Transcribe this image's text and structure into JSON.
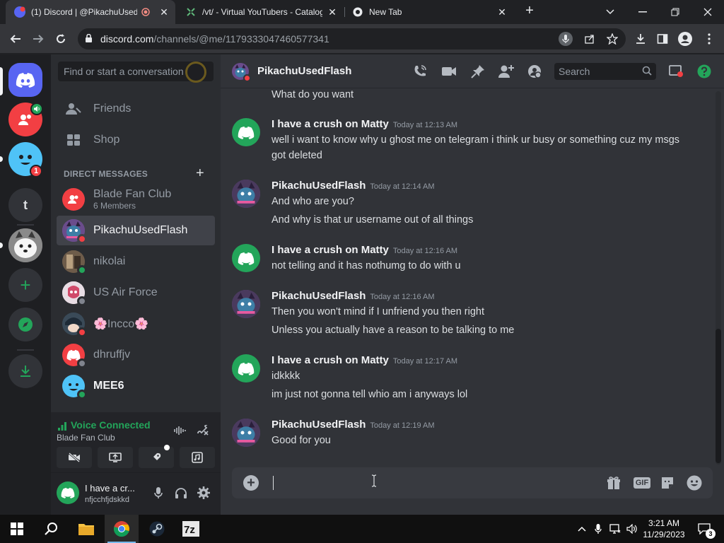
{
  "browser": {
    "tabs": [
      {
        "title": "(1) Discord | @PikachuUsedF",
        "active": true
      },
      {
        "title": "/vt/ - Virtual YouTubers - Catalog",
        "active": false
      },
      {
        "title": "New Tab",
        "active": false
      }
    ],
    "new_tab_label": "+",
    "url_host": "discord.com",
    "url_path": "/channels/@me/1179333047460577341"
  },
  "guilds": {
    "badge_count": "1",
    "text_guild_label": "t"
  },
  "dm_sidebar": {
    "search_placeholder": "Find or start a conversation",
    "nav": [
      {
        "label": "Friends"
      },
      {
        "label": "Shop"
      }
    ],
    "header": "DIRECT MESSAGES",
    "add_label": "+",
    "items": [
      {
        "name": "Blade Fan Club",
        "sub": "6 Members",
        "status": "group"
      },
      {
        "name": "PikachuUsedFlash",
        "sub": "",
        "status": "dnd"
      },
      {
        "name": "nikolai",
        "sub": "",
        "status": "online"
      },
      {
        "name": "US Air Force",
        "sub": "",
        "status": "offline"
      },
      {
        "name": "🌸Incco🌸",
        "sub": "",
        "status": "dnd"
      },
      {
        "name": "dhruffjv",
        "sub": "",
        "status": "offline"
      },
      {
        "name": "MEE6",
        "sub": "",
        "status": "online"
      }
    ]
  },
  "voice": {
    "status": "Voice Connected",
    "channel": "Blade Fan Club"
  },
  "user_panel": {
    "name": "I have a cr...",
    "tag": "nfjcchfjdskkd"
  },
  "chat": {
    "header_name": "PikachuUsedFlash",
    "search_placeholder": "Search",
    "composer_value": "",
    "messages": [
      {
        "author": "",
        "time": "",
        "lines": [
          "What do you want"
        ]
      },
      {
        "author": "I have a crush on Matty",
        "time": "Today at 12:13 AM",
        "lines": [
          "well i want to know why u ghost me on telegram i think ur busy or something cuz my msgs got deleted"
        ]
      },
      {
        "author": "PikachuUsedFlash",
        "time": "Today at 12:14 AM",
        "lines": [
          "And who are you?",
          "And why is that ur username out of all things"
        ]
      },
      {
        "author": "I have a crush on Matty",
        "time": "Today at 12:16 AM",
        "lines": [
          "not telling and it has nothumg to do with u"
        ]
      },
      {
        "author": "PikachuUsedFlash",
        "time": "Today at 12:16 AM",
        "lines": [
          "Then you won't mind if I unfriend you then right",
          "Unless you actually have a reason to be talking to me"
        ]
      },
      {
        "author": "I have a crush on Matty",
        "time": "Today at 12:17 AM",
        "lines": [
          "idkkkk",
          "im just not gonna tell whio am i anyways lol"
        ]
      },
      {
        "author": "PikachuUsedFlash",
        "time": "Today at 12:19 AM",
        "lines": [
          "Good for you"
        ]
      }
    ]
  },
  "composer_icons": {
    "gif_label": "GIF"
  },
  "taskbar": {
    "time": "3:21 AM",
    "date": "11/29/2023",
    "notification_count": "3"
  },
  "colors": {
    "blurple": "#5865f2",
    "discord_green": "#23a55a",
    "dnd_red": "#f23f43"
  }
}
